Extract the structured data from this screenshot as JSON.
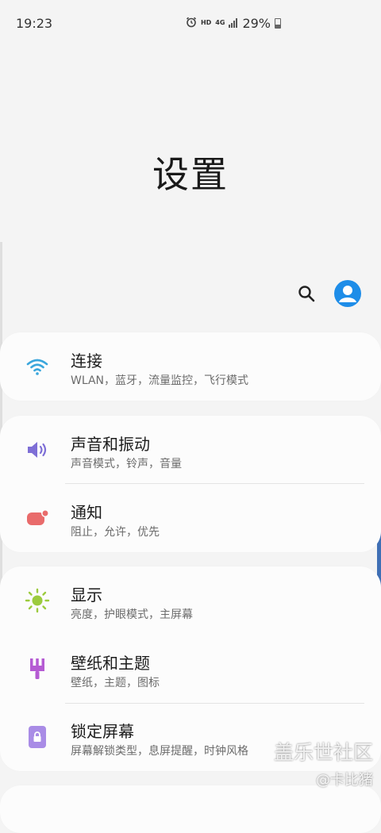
{
  "status_bar": {
    "time": "19:23",
    "hd_label": "HD",
    "network_label": "4G",
    "battery_percent": "29%",
    "battery_level": 0.29,
    "icons": [
      "alarm-icon",
      "hd-icon",
      "signal-4g-icon",
      "battery-icon"
    ]
  },
  "page": {
    "title": "设置"
  },
  "header": {
    "search_icon": "search-icon",
    "account_icon": "account-avatar-icon"
  },
  "settings": {
    "connections": {
      "title": "连接",
      "subtitle": "WLAN，蓝牙，流量监控，飞行模式",
      "icon": "wifi-icon",
      "color": "#3aa6dc"
    },
    "sound": {
      "title": "声音和振动",
      "subtitle": "声音模式，铃声，音量",
      "icon": "speaker-icon",
      "color": "#7e6fd6"
    },
    "notifications": {
      "title": "通知",
      "subtitle": "阻止，允许，优先",
      "icon": "notification-icon",
      "color": "#e96b6b"
    },
    "display": {
      "title": "显示",
      "subtitle": "亮度，护眼模式，主屏幕",
      "icon": "brightness-icon",
      "color": "#9ccb3e"
    },
    "wallpaper": {
      "title": "壁纸和主题",
      "subtitle": "壁纸，主题，图标",
      "icon": "paintbrush-icon",
      "color": "#b55bd3"
    },
    "lockscreen": {
      "title": "锁定屏幕",
      "subtitle": "屏幕解锁类型，息屏提醒，时钟风格",
      "icon": "lock-icon",
      "color": "#a98ce6"
    }
  },
  "watermark": {
    "site": "盖乐世社区",
    "author": "@卡比猪"
  }
}
